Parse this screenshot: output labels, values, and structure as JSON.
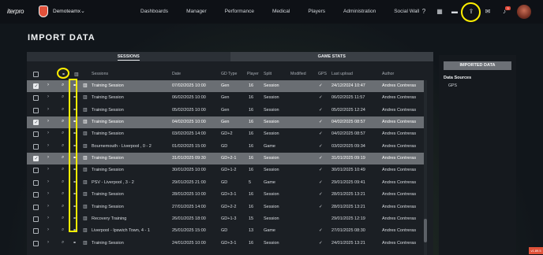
{
  "app": {
    "logo": "iterpro",
    "team": "Demoteamx",
    "nav": [
      "Dashboards",
      "Manager",
      "Performance",
      "Medical",
      "Players",
      "Administration",
      "Social Wall"
    ],
    "notification_count": "3",
    "version": "v1.89.5"
  },
  "page_title": "IMPORT DATA",
  "tabs": [
    {
      "label": "SESSIONS",
      "active": true
    },
    {
      "label": "GAME STATS",
      "active": false
    }
  ],
  "table": {
    "columns": [
      "Sessions",
      "Date",
      "GD Type",
      "Player",
      "Split",
      "Modified",
      "GPS",
      "Last upload",
      "Author"
    ],
    "rows": [
      {
        "session": "Training Session",
        "date": "07/02/2025 10:00",
        "gd_type": "Gen",
        "player": "16",
        "split": "Session",
        "modified": "",
        "gps": "✓",
        "last_upload": "24/12/2024 10:47",
        "author": "Andres Contreras",
        "checked": true,
        "selected": true
      },
      {
        "session": "Training Session",
        "date": "06/02/2025 10:00",
        "gd_type": "Gen",
        "player": "16",
        "split": "Session",
        "modified": "",
        "gps": "✓",
        "last_upload": "06/02/2025 11:57",
        "author": "Andres Contreras",
        "checked": false,
        "selected": false
      },
      {
        "session": "Training Session",
        "date": "05/02/2025 10:00",
        "gd_type": "Gen",
        "player": "16",
        "split": "Session",
        "modified": "",
        "gps": "✓",
        "last_upload": "05/02/2025 12:24",
        "author": "Andres Contreras",
        "checked": false,
        "selected": false
      },
      {
        "session": "Training Session",
        "date": "04/02/2025 10:00",
        "gd_type": "Gen",
        "player": "16",
        "split": "Session",
        "modified": "",
        "gps": "✓",
        "last_upload": "04/02/2025 08:57",
        "author": "Andres Contreras",
        "checked": true,
        "selected": true
      },
      {
        "session": "Training Session",
        "date": "03/02/2025 14:00",
        "gd_type": "GD+2",
        "player": "16",
        "split": "Session",
        "modified": "",
        "gps": "✓",
        "last_upload": "04/02/2025 08:57",
        "author": "Andres Contreras",
        "checked": false,
        "selected": false
      },
      {
        "session": "Bournemouth - Liverpool , 0 - 2",
        "date": "01/02/2025 15:00",
        "gd_type": "GD",
        "player": "16",
        "split": "Game",
        "modified": "",
        "gps": "✓",
        "last_upload": "03/02/2025 09:34",
        "author": "Andres Contreras",
        "checked": false,
        "selected": false
      },
      {
        "session": "Training Session",
        "date": "31/01/2025 09:30",
        "gd_type": "GD+2-1",
        "player": "16",
        "split": "Session",
        "modified": "",
        "gps": "✓",
        "last_upload": "31/01/2025 09:19",
        "author": "Andres Contreras",
        "checked": true,
        "selected": true
      },
      {
        "session": "Training Session",
        "date": "30/01/2025 10:00",
        "gd_type": "GD+1-2",
        "player": "16",
        "split": "Session",
        "modified": "",
        "gps": "✓",
        "last_upload": "30/01/2025 10:49",
        "author": "Andres Contreras",
        "checked": false,
        "selected": false
      },
      {
        "session": "PSV - Liverpool , 3 - 2",
        "date": "29/01/2025 21:00",
        "gd_type": "GD",
        "player": "5",
        "split": "Game",
        "modified": "",
        "gps": "✓",
        "last_upload": "29/01/2025 09:41",
        "author": "Andres Contreras",
        "checked": false,
        "selected": false
      },
      {
        "session": "Training Session",
        "date": "28/01/2025 10:00",
        "gd_type": "GD+3-1",
        "player": "16",
        "split": "Session",
        "modified": "",
        "gps": "✓",
        "last_upload": "28/01/2025 13:21",
        "author": "Andres Contreras",
        "checked": false,
        "selected": false
      },
      {
        "session": "Training Session",
        "date": "27/01/2025 14:00",
        "gd_type": "GD+2-2",
        "player": "16",
        "split": "Session",
        "modified": "",
        "gps": "✓",
        "last_upload": "28/01/2025 13:21",
        "author": "Andres Contreras",
        "checked": false,
        "selected": false
      },
      {
        "session": "Recovery Training",
        "date": "26/01/2025 18:00",
        "gd_type": "GD+1-3",
        "player": "15",
        "split": "Session",
        "modified": "",
        "gps": "",
        "last_upload": "29/01/2025 12:19",
        "author": "Andres Contreras",
        "checked": false,
        "selected": false
      },
      {
        "session": "Liverpool - Ipswich Town, 4 - 1",
        "date": "25/01/2025 15:00",
        "gd_type": "GD",
        "player": "13",
        "split": "Game",
        "modified": "",
        "gps": "✓",
        "last_upload": "27/01/2025 08:30",
        "author": "Andres Contreras",
        "checked": false,
        "selected": false
      },
      {
        "session": "Training Session",
        "date": "24/01/2025 10:00",
        "gd_type": "GD+3-1",
        "player": "16",
        "split": "Session",
        "modified": "",
        "gps": "✓",
        "last_upload": "24/01/2025 13:21",
        "author": "Andres Contreras",
        "checked": false,
        "selected": false
      }
    ]
  },
  "right_panel": {
    "button": "IMPORTED DATA",
    "label": "Data Sources",
    "source": "GPS"
  }
}
